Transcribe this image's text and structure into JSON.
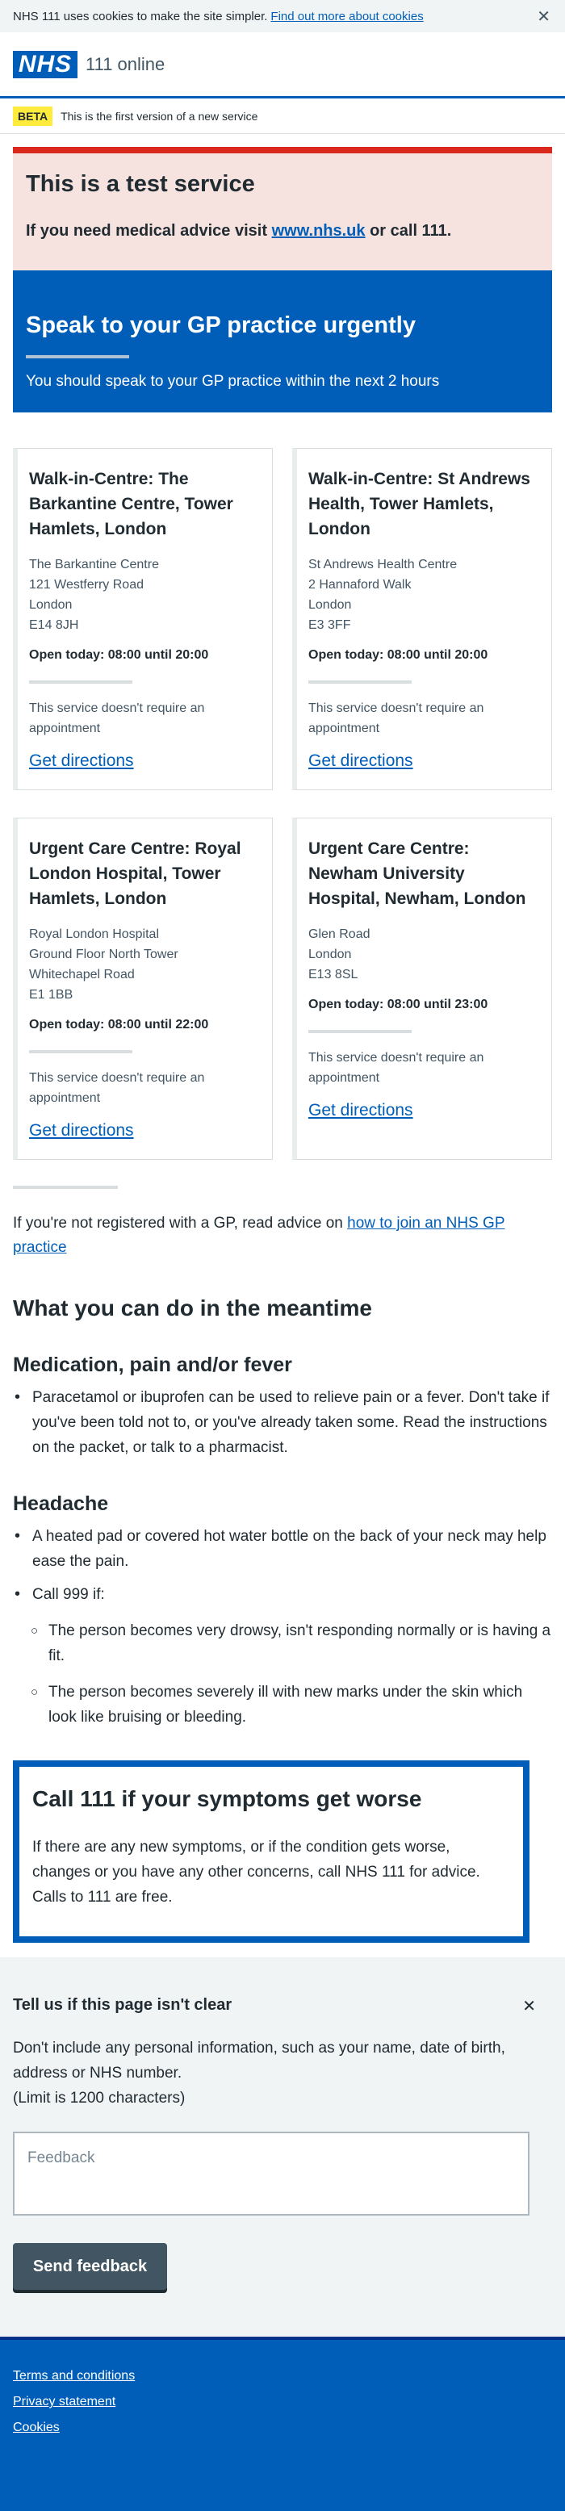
{
  "cookie": {
    "text": "NHS 111 uses cookies to make the site simpler.",
    "link": "Find out more about cookies",
    "close": "✕"
  },
  "header": {
    "logo": "NHS",
    "service": "111 online"
  },
  "beta": {
    "tag": "BETA",
    "text": "This is the first version of a new service"
  },
  "test_banner": {
    "title": "This is a test service",
    "text_before": "If you need medical advice visit",
    "link": "www.nhs.uk",
    "text_after": "or call 111."
  },
  "care_card": {
    "title": "Speak to your GP practice urgently",
    "text": "You should speak to your GP practice within the next 2 hours"
  },
  "services": [
    {
      "name": "Walk-in-Centre: The Barkantine Centre, Tower Hamlets, London",
      "address": [
        "The Barkantine Centre",
        "121 Westferry Road",
        "London",
        "E14 8JH"
      ],
      "open": "Open today: 08:00 until 20:00",
      "note": "This service doesn't require an appointment",
      "directions": "Get directions"
    },
    {
      "name": "Walk-in-Centre: St Andrews Health, Tower Hamlets, London",
      "address": [
        "St Andrews Health Centre",
        "2 Hannaford Walk",
        "London",
        "E3 3FF"
      ],
      "open": "Open today: 08:00 until 20:00",
      "note": "This service doesn't require an appointment",
      "directions": "Get directions"
    },
    {
      "name": "Urgent Care Centre: Royal London Hospital, Tower Hamlets, London",
      "address": [
        "Royal London Hospital",
        "Ground Floor North Tower",
        "Whitechapel Road",
        "E1 1BB"
      ],
      "open": "Open today: 08:00 until 22:00",
      "note": "This service doesn't require an appointment",
      "directions": "Get directions"
    },
    {
      "name": "Urgent Care Centre: Newham University Hospital, Newham, London",
      "address": [
        "Glen Road",
        "London",
        "E13 8SL"
      ],
      "open": "Open today: 08:00 until 23:00",
      "note": "This service doesn't require an appointment",
      "directions": "Get directions"
    }
  ],
  "gp_advice": {
    "text": "If you're not registered with a GP, read advice on",
    "link": "how to join an NHS GP practice"
  },
  "meantime": {
    "title": "What you can do in the meantime",
    "medication": {
      "title": "Medication, pain and/or fever",
      "items": [
        "Paracetamol or ibuprofen can be used to relieve pain or a fever. Don't take if you've been told not to, or you've already taken some. Read the instructions on the packet, or talk to a pharmacist."
      ]
    },
    "headache": {
      "title": "Headache",
      "items": [
        "A heated pad or covered hot water bottle on the back of your neck may help ease the pain.",
        "Call 999 if:"
      ],
      "sub_items": [
        "The person becomes very drowsy, isn't responding normally or is having a fit.",
        "The person becomes severely ill with new marks under the skin which look like bruising or bleeding."
      ]
    }
  },
  "call111": {
    "title": "Call 111 if your symptoms get worse",
    "text": "If there are any new symptoms, or if the condition gets worse, changes or you have any other concerns, call NHS 111 for advice. Calls to 111 are free."
  },
  "feedback": {
    "title": "Tell us if this page isn't clear",
    "close": "✕",
    "text": "Don't include any personal information, such as your name, date of birth, address or NHS number.",
    "limit": "(Limit is 1200 characters)",
    "placeholder": "Feedback",
    "send": "Send feedback"
  },
  "footer": {
    "links": [
      "Terms and conditions",
      "Privacy statement",
      "Cookies"
    ]
  },
  "colors": {
    "nhs_blue": "#005eb8",
    "red": "#da291c",
    "yellow": "#ffeb3b",
    "grey": "#425563"
  }
}
